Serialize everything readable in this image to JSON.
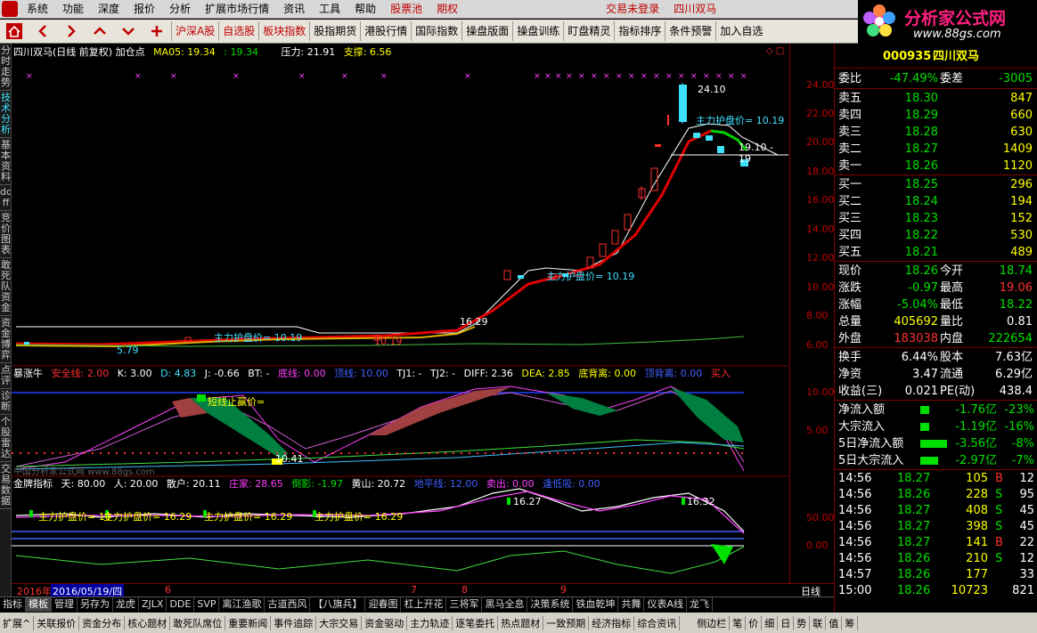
{
  "menu": [
    "系统",
    "功能",
    "深度",
    "报价",
    "分析",
    "扩展市场行情",
    "资讯",
    "工具",
    "帮助",
    "股票池",
    "期权",
    "交易未登录",
    "四川双马"
  ],
  "toolbar": [
    "沪深A股",
    "自选股",
    "板块指数",
    "股指期货",
    "港股行情",
    "国际指数",
    "操盘版面",
    "操盘训练",
    "盯盘精灵",
    "指标排序",
    "条件预警",
    "加入自选"
  ],
  "logo": {
    "title": "分析家公式网",
    "url": "www.88gs.com"
  },
  "left_tabs": [
    "分时走势",
    "技术分析",
    "基本资料",
    "dd ff",
    "竞价图表",
    "敢死队资金",
    "资金博弈",
    "点评",
    "诊断",
    "个股雷达",
    "交易数据"
  ],
  "main_panel": {
    "header": [
      "四川双马(日线 前复权) 加仓点",
      "MA05: 19.34",
      ": 19.34",
      "压力: 21.91",
      "支撑: 6.56"
    ],
    "annotations": [
      "24.10",
      "主力护盘价= 10.19",
      "19.10 - 19",
      "主力护盘价= 10.19",
      "16.29",
      "10.19",
      "主力护盘价= 10.19",
      "5.79"
    ],
    "axis_labels": [
      "24.00",
      "22.00",
      "20.00",
      "18.00",
      "16.00",
      "14.00",
      "12.00",
      "10.00",
      "8.00",
      "6.00"
    ]
  },
  "mid_panel": {
    "header": [
      "暴涨牛",
      "安全线: 2.00",
      "K: 3.00",
      "D: 4.83",
      "J: -0.66",
      "BT: -",
      "底线: 0.00",
      "顶线: 10.00",
      "TJ1: -",
      "TJ2: -",
      "DIFF: 2.36",
      "DEA: 2.85",
      "底背离: 0.00",
      "顶背离: 0.00",
      "买入"
    ],
    "annotations": [
      "短线止赢价=",
      "10.41",
      "中国分析家公式网 www.88gs.com"
    ],
    "axis_labels": [
      "10.00",
      "5.00"
    ]
  },
  "low_panel": {
    "header": [
      "金牌指标",
      "天: 80.00",
      "人: 20.00",
      "散户: 20.11",
      "庄家: 28.65",
      "倒影: -1.97",
      "黄山: 20.72",
      "地平线: 12.00",
      "卖出: 0.00",
      "逢低吸: 0.00"
    ],
    "annotations": [
      "主力护盘价= 10",
      "主力护盘价= 16.29",
      "主力护盘价= 16.29",
      "主力护盘价= 16.29",
      "16.27",
      "16.32"
    ],
    "axis_labels": [
      "50.00",
      "0.00"
    ]
  },
  "dates": [
    "2016年",
    "2016/05/19/四",
    "6",
    "7",
    "8",
    "9"
  ],
  "week_label": "日线",
  "bottom_tabs": [
    "指标",
    "模板",
    "管理",
    "另存为",
    "龙虎",
    "ZJLX",
    "DDE",
    "SVP",
    "离江渔歌",
    "古道西风",
    "【八旗兵】",
    "迎春图",
    "杠上开花",
    "三将军",
    "黑马全息",
    "决策系统",
    "铁血乾坤",
    "共舞",
    "仪表A线",
    "龙飞"
  ],
  "status_tabs": [
    "扩展^",
    "关联报价",
    "资金分布",
    "核心题材",
    "敢死队席位",
    "重要新闻",
    "事件追踪",
    "大宗交易",
    "资金驱动",
    "主力轨迹",
    "逐笔委托",
    "热点题材",
    "一致预期",
    "经济指标",
    "综合资讯",
    "侧边栏",
    "笔",
    "价",
    "细",
    "日",
    "势",
    "联",
    "值",
    "筹"
  ],
  "quote": {
    "code": "000935",
    "name": "四川双马",
    "wb": "-47.49%",
    "wc": "-3005",
    "sell": [
      [
        "卖五",
        "18.30",
        "847"
      ],
      [
        "卖四",
        "18.29",
        "660"
      ],
      [
        "卖三",
        "18.28",
        "630"
      ],
      [
        "卖二",
        "18.27",
        "1409"
      ],
      [
        "卖一",
        "18.26",
        "1120"
      ]
    ],
    "buy": [
      [
        "买一",
        "18.25",
        "296"
      ],
      [
        "买二",
        "18.24",
        "194"
      ],
      [
        "买三",
        "18.23",
        "152"
      ],
      [
        "买四",
        "18.22",
        "530"
      ],
      [
        "买五",
        "18.21",
        "489"
      ]
    ],
    "stats": [
      [
        "现价",
        "18.26",
        "今开",
        "18.74"
      ],
      [
        "涨跌",
        "-0.97",
        "最高",
        "19.06"
      ],
      [
        "涨幅",
        "-5.04%",
        "最低",
        "18.22"
      ],
      [
        "总量",
        "405692",
        "量比",
        "0.81"
      ],
      [
        "外盘",
        "183038",
        "内盘",
        "222654"
      ]
    ],
    "fin": [
      [
        "换手",
        "6.44%",
        "股本",
        "7.63亿"
      ],
      [
        "净资",
        "3.47",
        "流通",
        "6.29亿"
      ],
      [
        "收益(三)",
        "0.021",
        "PE(动)",
        "438.4"
      ]
    ],
    "flow": [
      [
        "净流入额",
        "-1.76亿",
        "-23%"
      ],
      [
        "大宗流入",
        "-1.19亿",
        "-16%"
      ],
      [
        "5日净流入额",
        "-3.56亿",
        "-8%"
      ],
      [
        "5日大宗流入",
        "-2.97亿",
        "-7%"
      ]
    ],
    "ticks": [
      [
        "14:56",
        "18.27",
        "105",
        "B",
        "12"
      ],
      [
        "14:56",
        "18.26",
        "228",
        "S",
        "95"
      ],
      [
        "14:56",
        "18.27",
        "408",
        "S",
        "45"
      ],
      [
        "14:56",
        "18.27",
        "398",
        "S",
        "45"
      ],
      [
        "14:56",
        "18.27",
        "141",
        "B",
        "22"
      ],
      [
        "14:56",
        "18.26",
        "210",
        "S",
        "12"
      ],
      [
        "14:57",
        "18.26",
        "177",
        "",
        "33"
      ],
      [
        "15:00",
        "18.26",
        "10723",
        "",
        "821"
      ]
    ]
  },
  "labels": {
    "weibi": "委比",
    "weicha": "委差"
  }
}
